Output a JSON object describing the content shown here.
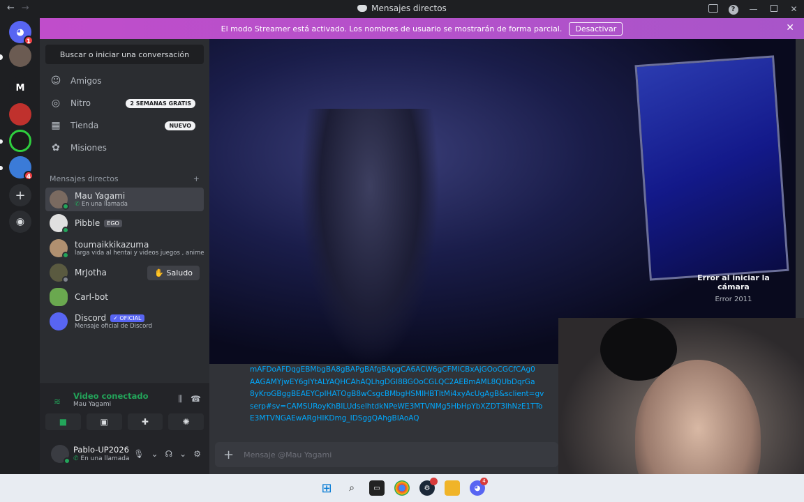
{
  "window": {
    "title": "Mensajes directos"
  },
  "streamer_banner": {
    "text": "El modo Streamer está activado. Los nombres de usuario se mostrarán de forma parcial.",
    "button": "Desactivar"
  },
  "guilds": [
    {
      "name": "discord-home-icon",
      "badge": "1"
    },
    {
      "name": "server-avatar-1"
    },
    {
      "name": "server-m",
      "letter": "M"
    },
    {
      "name": "server-avatar-2"
    },
    {
      "name": "server-avatar-3"
    },
    {
      "name": "server-avatar-4",
      "badge": "4"
    },
    {
      "name": "add-server-icon"
    },
    {
      "name": "explore-icon"
    }
  ],
  "sidebar": {
    "search_label": "Buscar o iniciar una conversación",
    "nav": [
      {
        "label": "Amigos",
        "icon": "friends-icon"
      },
      {
        "label": "Nitro",
        "icon": "nitro-icon",
        "pill": "2 SEMANAS GRATIS"
      },
      {
        "label": "Tienda",
        "icon": "shop-icon",
        "pill": "NUEVO"
      },
      {
        "label": "Misiones",
        "icon": "quests-icon"
      }
    ],
    "dm_header": "Mensajes directos",
    "dms": [
      {
        "name": "Mau Yagami",
        "sub": "En una llamada"
      },
      {
        "name": "Pibble",
        "tag": "EGO"
      },
      {
        "name": "toumaikkikazuma",
        "sub": "larga vida al hentai y videos juegos , anime"
      },
      {
        "name": "MrJotha",
        "action": "Saludo"
      },
      {
        "name": "Carl-bot"
      },
      {
        "name": "Discord",
        "tag": "OFICIAL",
        "sub": "Mensaje oficial de Discord"
      }
    ]
  },
  "voice": {
    "status": "Video conectado",
    "channel": "Mau Yagami"
  },
  "user": {
    "name": "Pablo-UP2026",
    "status": "En una llamada"
  },
  "call": {
    "error_title": "Error al iniciar la cámara",
    "error_code": "Error 2011"
  },
  "message": {
    "lines": [
      "mAFDoAFDqgEBMbgBA8gBAPgBAfgBApgCA6ACW6gCFMICBxAjGOoCGCfCAg0",
      "AAGAMYjwEY6gIYtALYAQHCAhAQLhgDGI8BGOoCGLQC2AEBmAML8QUbDqrGa",
      "8yKroGBggBEAEYCpIHATOgB8wCsgcBMbgHSMIHBTItMi4xyAcUgAgB&sclient=gv",
      "serp#sv=CAMSURoyKhBlLUdselhtdkNPeWE3MTVNMg5HbHpYbXZDT3lhNzE1TTo",
      "E3MTVNGAEwARgHIKDmg_IDSggQAhgBIAoAQ"
    ]
  },
  "composer": {
    "placeholder": "Mensaje @Mau Yagami"
  },
  "taskbar": {
    "items": [
      "windows-start-icon",
      "search-icon",
      "file-explorer-icon",
      "chrome-icon",
      "steam-icon",
      "folder-icon",
      "discord-icon"
    ]
  }
}
